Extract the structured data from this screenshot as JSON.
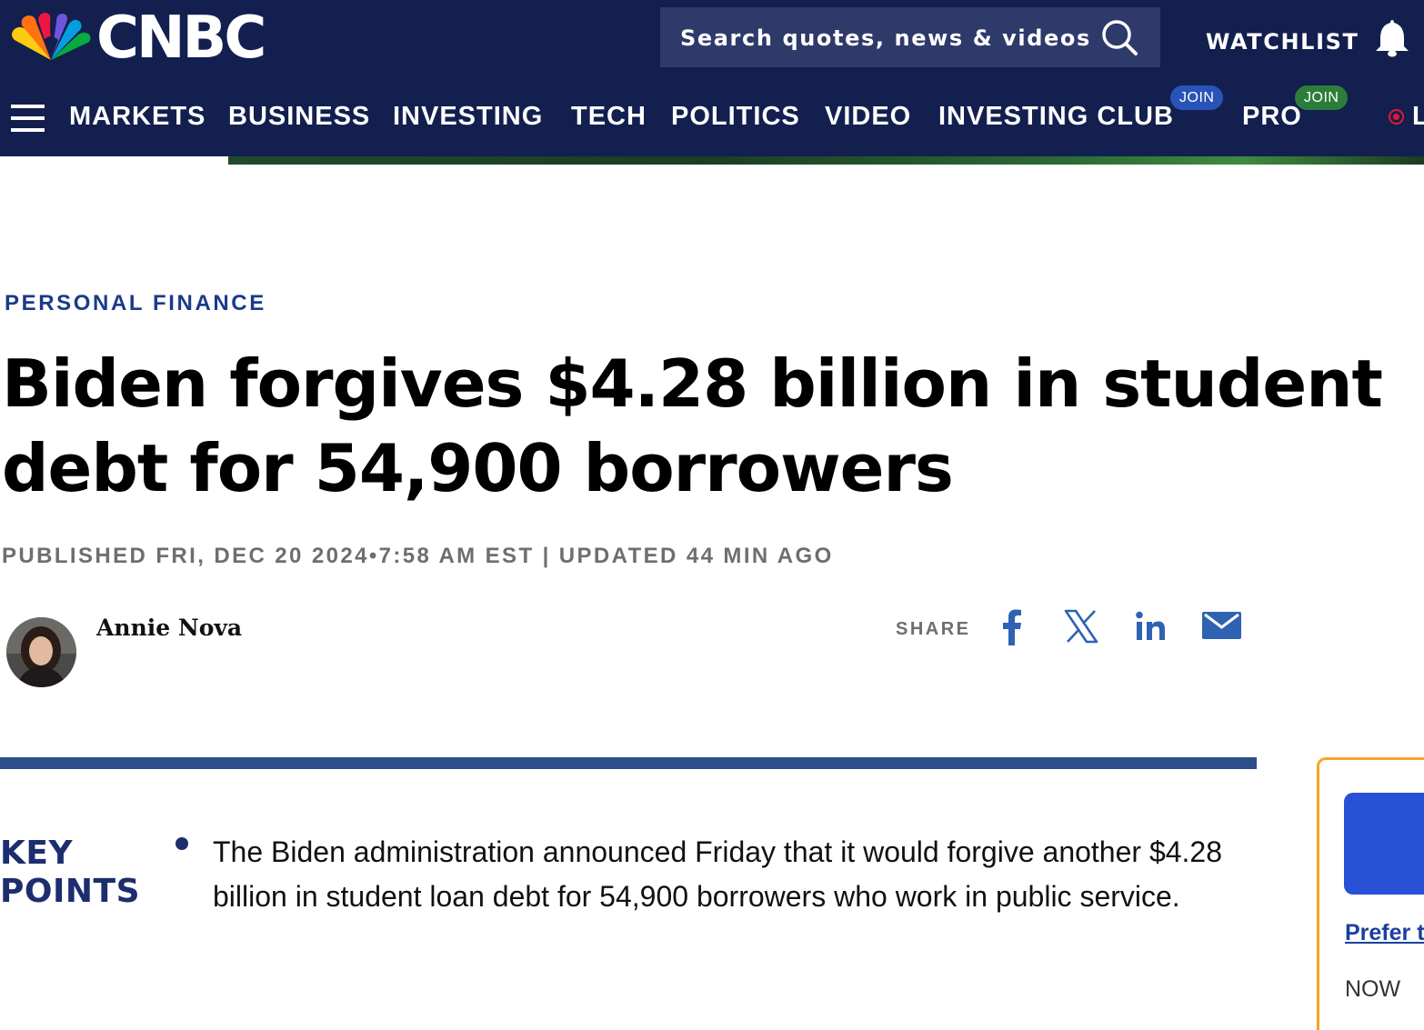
{
  "header": {
    "logo_text": "CNBC",
    "search_placeholder": "Search quotes, news & videos",
    "watchlist_label": "WATCHLIST",
    "nav": [
      {
        "label": "MARKETS"
      },
      {
        "label": "BUSINESS"
      },
      {
        "label": "INVESTING"
      },
      {
        "label": "TECH"
      },
      {
        "label": "POLITICS"
      },
      {
        "label": "VIDEO"
      },
      {
        "label": "INVESTING CLUB",
        "badge": "JOIN"
      },
      {
        "label": "PRO",
        "badge": "JOIN"
      }
    ],
    "live_label": "L",
    "colors": {
      "background": "#131f4f",
      "join_club": "#2a53b8",
      "join_pro": "#2d7d3a",
      "live": "#e3182d"
    }
  },
  "article": {
    "section": "PERSONAL FINANCE",
    "headline": "Biden forgives $4.28 billion in student debt for 54,900 borrowers",
    "dateline": "PUBLISHED FRI, DEC 20 2024•7:58 AM EST | UPDATED 44 MIN AGO",
    "author": "Annie Nova",
    "share_label": "SHARE",
    "share_icons": [
      "facebook-icon",
      "x-icon",
      "linkedin-icon",
      "email-icon"
    ],
    "key_points_label": [
      "KEY",
      "POINTS"
    ],
    "key_points": [
      "The Biden administration announced Friday that it would forgive another $4.28 billion in student loan debt for 54,900 borrowers who work in public service."
    ]
  },
  "sidebar": {
    "link_text": "Prefer t",
    "now_text": "NOW"
  }
}
